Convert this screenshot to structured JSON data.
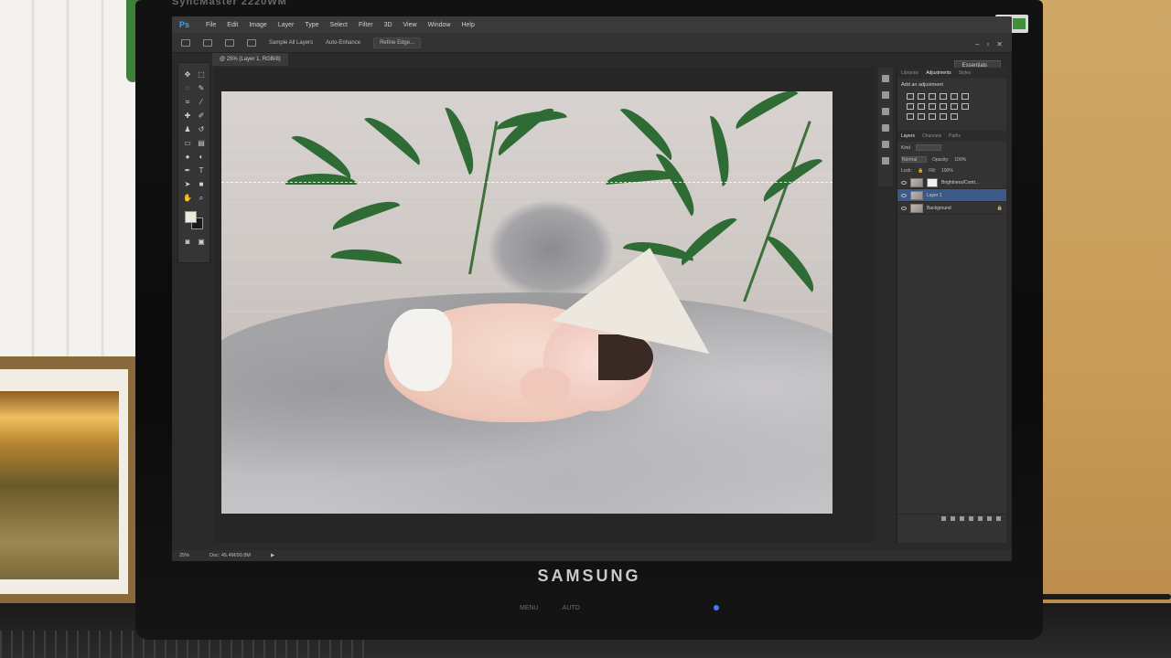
{
  "monitor": {
    "model": "SyncMaster 2220WM",
    "brand": "SAMSUNG",
    "bezel_buttons": [
      "MENU",
      "AUTO"
    ]
  },
  "app": {
    "logo": "Ps",
    "menu": [
      "File",
      "Edit",
      "Image",
      "Layer",
      "Type",
      "Select",
      "Filter",
      "3D",
      "View",
      "Window",
      "Help"
    ],
    "options": {
      "sample_all_layers": "Sample All Layers",
      "auto_enhance": "Auto-Enhance",
      "refine_edge": "Refine Edge..."
    },
    "document_tab": "@ 25% (Layer 1, RGB/8)",
    "workspace": "Essentials",
    "status": {
      "zoom": "25%",
      "doc": "Doc: 45.4M/90.8M"
    }
  },
  "panels": {
    "top_tabs": [
      "Libraries",
      "Adjustments",
      "Styles"
    ],
    "active_top_tab": "Adjustments",
    "add_adjustment": "Add an adjustment",
    "layer_tabs": [
      "Layers",
      "Channels",
      "Paths"
    ],
    "kind": "Kind",
    "blend_mode": "Normal",
    "opacity_label": "Opacity:",
    "opacity_value": "100%",
    "lock_label": "Lock:",
    "fill_label": "Fill:",
    "fill_value": "100%",
    "layers": [
      {
        "name": "Brightness/Contr...",
        "selected": false
      },
      {
        "name": "Layer 1",
        "selected": true
      },
      {
        "name": "Background",
        "selected": false
      }
    ]
  },
  "colors": {
    "ps_blue": "#31a8ff",
    "selection_blue": "#3b5a8a",
    "foreground_swatch": "#f0e9db",
    "background_swatch": "#1a1a1a"
  }
}
